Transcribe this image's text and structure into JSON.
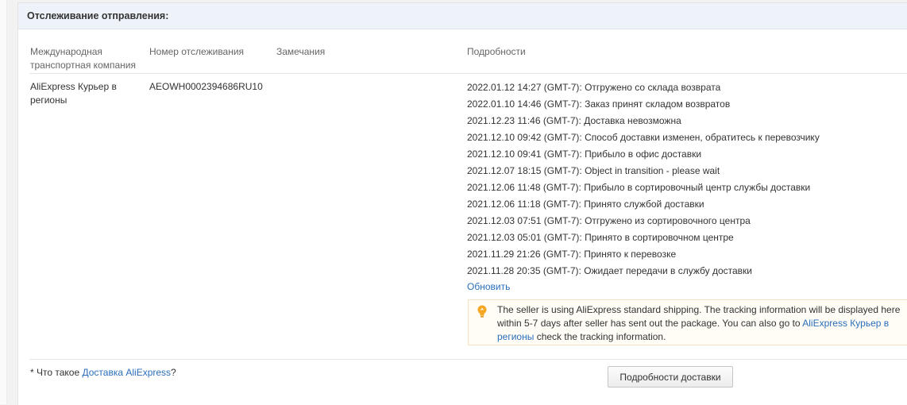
{
  "section_title": "Отслеживание отправления:",
  "columns": {
    "carrier": "Международная транспортная компания",
    "tracking_number": "Номер отслеживания",
    "remarks": "Замечания",
    "details": "Подробности"
  },
  "row": {
    "carrier": "AliExpress Курьер в регионы",
    "tracking_number": "AEOWH0002394686RU10",
    "remarks": ""
  },
  "events": [
    "2022.01.12 14:27 (GMT-7): Отгружено со склада возврата",
    "2022.01.10 14:46 (GMT-7): Заказ принят складом возвратов",
    "2021.12.23 11:46 (GMT-7): Доставка невозможна",
    "2021.12.10 09:42 (GMT-7): Способ доставки изменен, обратитесь к перевозчику",
    "2021.12.10 09:41 (GMT-7): Прибыло в офис доставки",
    "2021.12.07 18:15 (GMT-7): Object in transition - please wait",
    "2021.12.06 11:48 (GMT-7): Прибыло в сортировочный центр службы доставки",
    "2021.12.06 11:18 (GMT-7): Принято службой доставки",
    "2021.12.03 07:51 (GMT-7): Отгружено из сортировочного центра",
    "2021.12.03 05:01 (GMT-7): Принято в сортировочном центре",
    "2021.11.29 21:26 (GMT-7): Принято к перевозке",
    "2021.11.28 20:35 (GMT-7): Ожидает передачи в службу доставки"
  ],
  "refresh_link": "Обновить",
  "notice": {
    "text_before": "The seller is using AliExpress standard shipping. The tracking information will be displayed here within 5-7 days after seller has sent out the package. You can also go to ",
    "link": "AliExpress Курьер в регионы",
    "text_after": " check the tracking information."
  },
  "footnote": {
    "prefix": "* Что такое ",
    "link": "Доставка AliExpress",
    "suffix": "?"
  },
  "details_button": "Подробности доставки",
  "colors": {
    "link": "#2a6ebb",
    "header_bg": "#eef3fa",
    "notice_border": "#f3e2bf",
    "bulb": "#f5a623"
  }
}
